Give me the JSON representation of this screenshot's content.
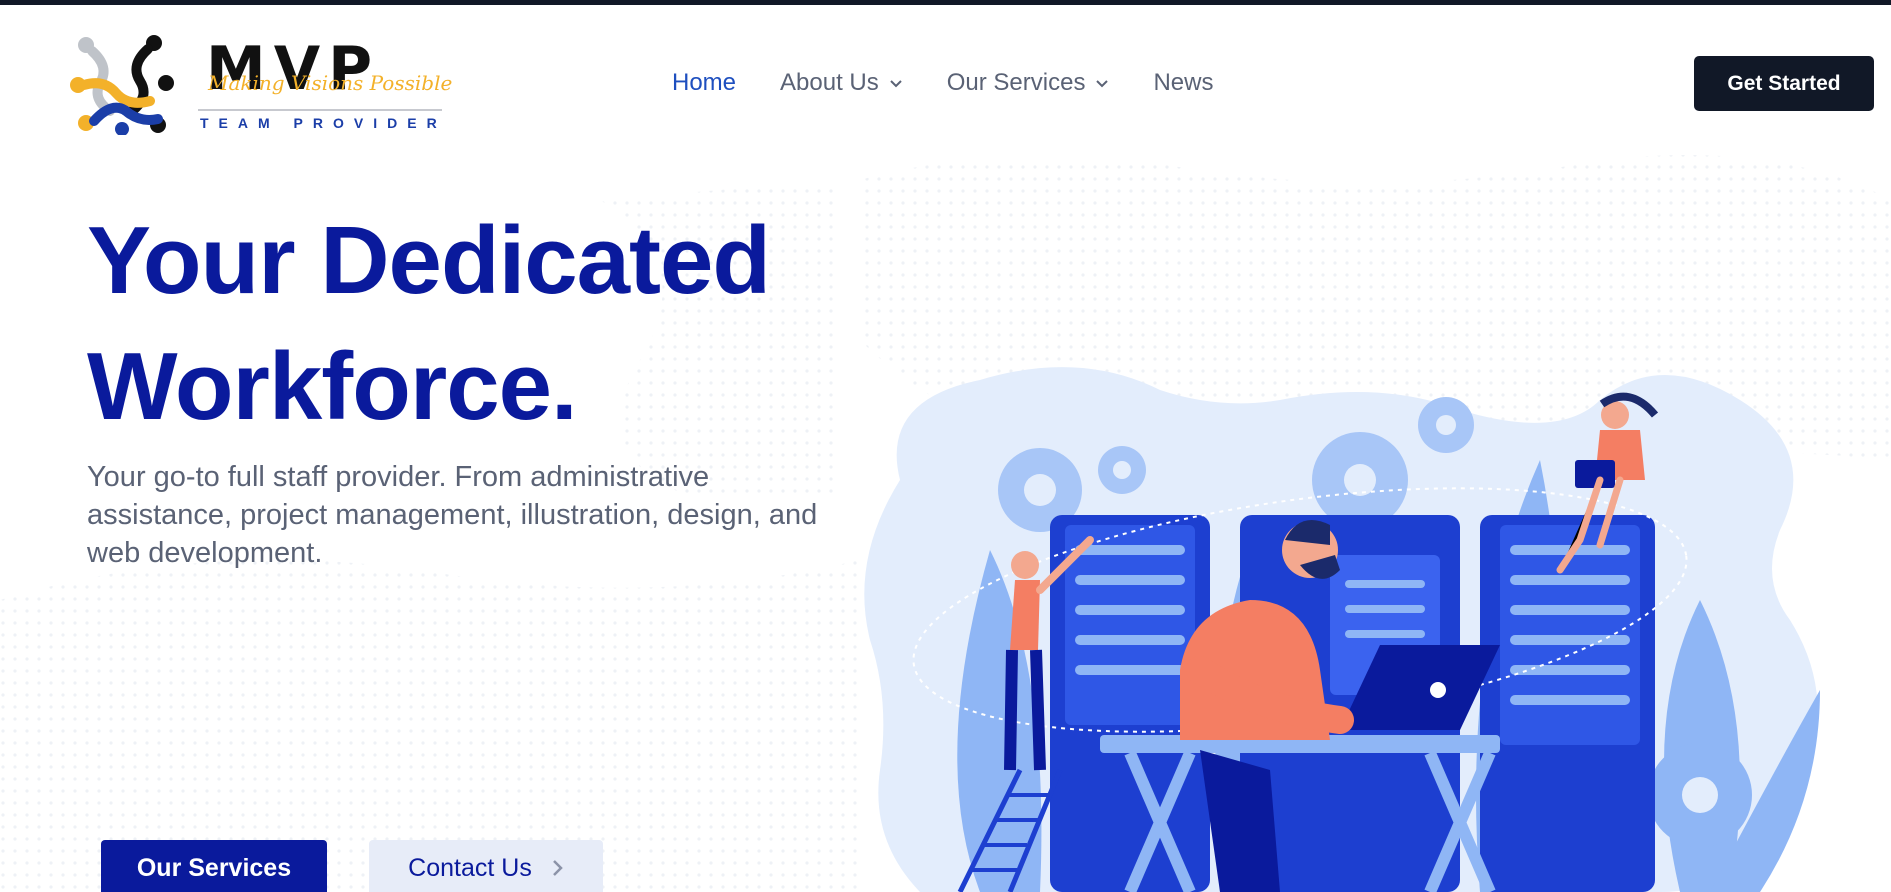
{
  "brand": {
    "wordmark": "MVP",
    "script": "Making Visions Possible",
    "tagline": "TEAM PROVIDER",
    "colors": {
      "navy": "#0a1a9c",
      "dark": "#111827",
      "accent_yellow": "#f3b12a",
      "blue": "#1b3ea8"
    }
  },
  "nav": {
    "items": [
      {
        "label": "Home",
        "active": true,
        "has_dropdown": false
      },
      {
        "label": "About Us",
        "active": false,
        "has_dropdown": true
      },
      {
        "label": "Our Services",
        "active": false,
        "has_dropdown": true
      },
      {
        "label": "News",
        "active": false,
        "has_dropdown": false
      }
    ],
    "cta_label": "Get Started"
  },
  "hero": {
    "title_line1": "Your Dedicated",
    "title_line2": "Workforce.",
    "subtitle": "Your go-to full staff provider. From administrative assistance, project management, illustration, design, and web development.",
    "primary_button": "Our Services",
    "secondary_button": "Contact Us",
    "illustration_icon": "team-at-servers-illustration"
  }
}
